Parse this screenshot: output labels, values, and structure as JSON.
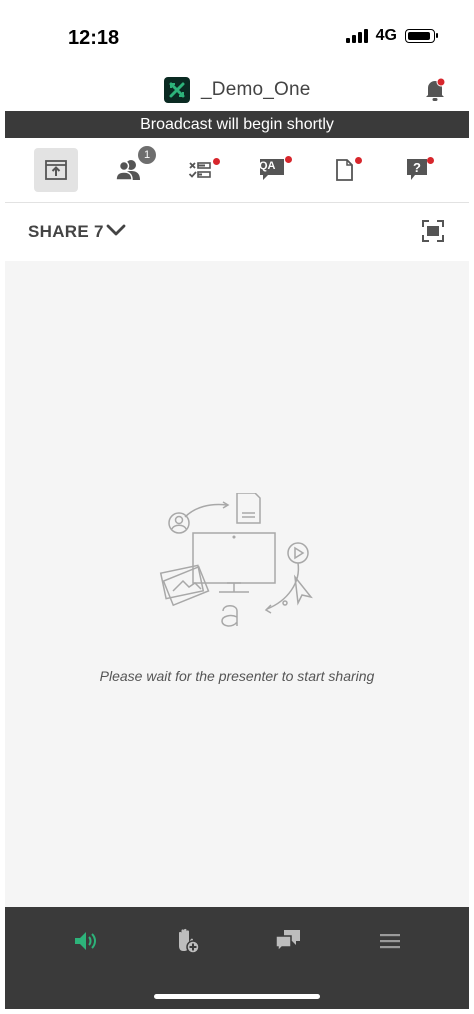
{
  "status_bar": {
    "time": "12:18",
    "network": "4G",
    "signal_icon": "signal-bars-icon",
    "battery_icon": "battery-icon"
  },
  "header": {
    "title": "_Demo_One",
    "logo_icon": "adobe-connect-logo-icon",
    "notification_icon": "bell-icon",
    "notification_dot_color": "#d7262c"
  },
  "banner": {
    "text": "Broadcast will begin shortly"
  },
  "toolbar": {
    "items": [
      {
        "name": "share-pod",
        "icon": "share-upload-icon",
        "selected": true
      },
      {
        "name": "attendees",
        "icon": "attendees-icon",
        "badge": "1"
      },
      {
        "name": "polls",
        "icon": "poll-icon",
        "dot": true
      },
      {
        "name": "qa",
        "icon": "qa-icon",
        "label": "QA",
        "dot": true
      },
      {
        "name": "files",
        "icon": "file-icon",
        "dot": true
      },
      {
        "name": "help",
        "icon": "question-icon",
        "dot": true
      }
    ]
  },
  "share_row": {
    "label": "SHARE 7",
    "chevron_icon": "chevron-down-icon",
    "fullscreen_icon": "fullscreen-icon"
  },
  "content": {
    "wait_message": "Please wait for the presenter to start sharing"
  },
  "bottom_bar": {
    "items": [
      {
        "name": "audio",
        "icon": "speaker-icon",
        "color": "#2db37a"
      },
      {
        "name": "raise-hand",
        "icon": "raise-hand-icon"
      },
      {
        "name": "chat",
        "icon": "chat-icon"
      },
      {
        "name": "menu",
        "icon": "hamburger-menu-icon"
      }
    ]
  },
  "colors": {
    "accent_green": "#2db37a",
    "banner_bg": "#3a3a3a",
    "alert_red": "#d7262c"
  }
}
